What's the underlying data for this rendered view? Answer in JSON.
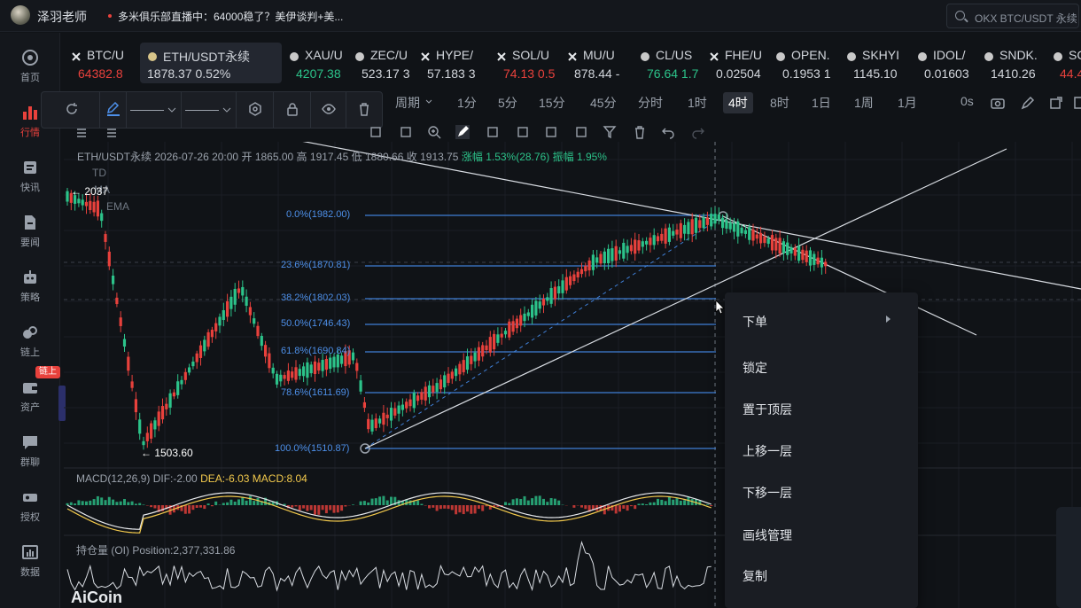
{
  "topbar": {
    "username": "泽羽老师",
    "news": "多米俱乐部直播中：64000稳了？美伊谈判+美...",
    "search_placeholder": "OKX BTC/USDT 永续"
  },
  "sidebar": {
    "items": [
      {
        "label": "首页",
        "icon": "home-icon"
      },
      {
        "label": "行情",
        "icon": "chart-bars-icon"
      },
      {
        "label": "快讯",
        "icon": "newsfeed-icon"
      },
      {
        "label": "要闻",
        "icon": "document-icon"
      },
      {
        "label": "策略",
        "icon": "robot-icon"
      },
      {
        "label": "链上",
        "icon": "chain-icon"
      },
      {
        "label": "资产",
        "icon": "wallet-icon"
      },
      {
        "label": "群聊",
        "icon": "chat-icon"
      },
      {
        "label": "授权",
        "icon": "key-icon"
      },
      {
        "label": "数据",
        "icon": "data-icon"
      }
    ],
    "badge": "链上"
  },
  "ticker": [
    {
      "name": "BTC/U",
      "price": "64382.8",
      "dir": "dn",
      "icon": "x-icon"
    },
    {
      "name": "ETH/USDT永续",
      "price": "1878.37  0.52%",
      "dir": "wh",
      "icon": "coin-icon"
    },
    {
      "name": "XAU/U",
      "price": "4207.38",
      "dir": "up",
      "icon": "coin-icon"
    },
    {
      "name": "ZEC/U",
      "price": "523.17  3",
      "dir": "wh",
      "icon": "coin-icon"
    },
    {
      "name": "HYPE/",
      "price": "57.183  3",
      "dir": "wh",
      "icon": "x-icon"
    },
    {
      "name": "SOL/U",
      "price": "74.13  0.5",
      "dir": "dn",
      "icon": "x-icon"
    },
    {
      "name": "MU/U",
      "price": "878.44  -",
      "dir": "wh",
      "icon": "x-icon"
    },
    {
      "name": "CL/US",
      "price": "76.64  1.7",
      "dir": "up",
      "icon": "coin-icon"
    },
    {
      "name": "FHE/U",
      "price": "0.02504",
      "dir": "wh",
      "icon": "x-icon"
    },
    {
      "name": "OPEN.",
      "price": "0.1953  1",
      "dir": "wh",
      "icon": "coin-icon"
    },
    {
      "name": "SKHYI",
      "price": "1145.10",
      "dir": "wh",
      "icon": "coin-icon"
    },
    {
      "name": "IDOL/",
      "price": "0.01603",
      "dir": "wh",
      "icon": "coin-icon"
    },
    {
      "name": "SNDK.",
      "price": "1410.26",
      "dir": "wh",
      "icon": "coin-icon"
    },
    {
      "name": "SC",
      "price": "44.45",
      "dir": "dn",
      "icon": "coin-icon"
    }
  ],
  "toolbar": {
    "period_label": "周期",
    "intervals": [
      "1分",
      "5分",
      "15分",
      "45分",
      "分时",
      "1时",
      "4时",
      "8时",
      "1日",
      "1周",
      "1月"
    ],
    "active_interval": "4时",
    "time_readout": "0s"
  },
  "legend": {
    "symbol": "ETH/USDT永续",
    "datetime": "2026-07-26 20:00",
    "open_label": "开",
    "open": "1865.00",
    "high_label": "高",
    "high": "1917.45",
    "low_label": "低",
    "low": "1880.66",
    "close_label": "收",
    "close": "1913.75",
    "change_label": "涨幅",
    "change": "1.53%(28.76)",
    "amp_label": "振幅",
    "amp": "1.95%"
  },
  "indicators": [
    "TD",
    "MA",
    "EMA"
  ],
  "price_marks": {
    "high": "← 2037",
    "low": "← 1503.60"
  },
  "fib_levels": [
    {
      "label": "0.0%(1982.00)"
    },
    {
      "label": "23.6%(1870.81)"
    },
    {
      "label": "38.2%(1802.03)"
    },
    {
      "label": "50.0%(1746.43)"
    },
    {
      "label": "61.8%(1690.84)"
    },
    {
      "label": "78.6%(1611.69)"
    },
    {
      "label": "100.0%(1510.87)"
    }
  ],
  "macd": {
    "title": "MACD(12,26,9)",
    "dif": "DIF:-2.00",
    "dea": "DEA:-6.03",
    "macd": "MACD:8.04"
  },
  "oi": {
    "title": "持仓量 (OI)",
    "position": "Position:2,377,331.86"
  },
  "watermark": "AiCoin",
  "context_menu": {
    "items": [
      "下单",
      "锁定",
      "置于顶层",
      "上移一层",
      "下移一层",
      "画线管理",
      "复制"
    ]
  },
  "colors": {
    "up": "#2cc38a",
    "down": "#e8413c",
    "fib": "#4d8fe8",
    "accent": "#e8413c"
  }
}
